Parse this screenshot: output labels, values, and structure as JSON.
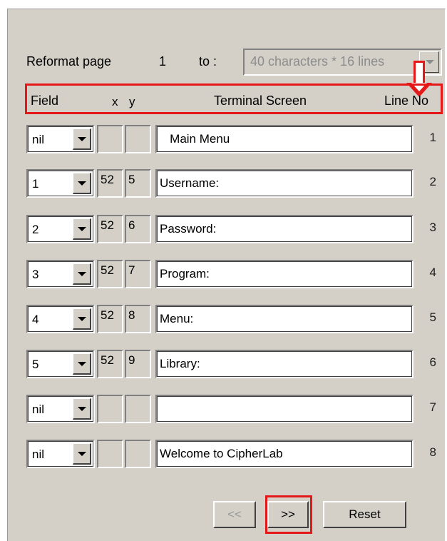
{
  "reformat": {
    "label": "Reformat page",
    "page_number": "1",
    "to_label": "to :",
    "dropdown_value": "40 characters * 16 lines"
  },
  "headers": {
    "field": "Field",
    "x": "x",
    "y": "y",
    "terminal_screen": "Terminal Screen",
    "line_no": "Line No"
  },
  "rows": [
    {
      "field": "nil",
      "x": "",
      "y": "",
      "text": "   Main Menu",
      "line": "1"
    },
    {
      "field": "1",
      "x": "52",
      "y": "5",
      "text": "Username:",
      "line": "2"
    },
    {
      "field": "2",
      "x": "52",
      "y": "6",
      "text": "Password:",
      "line": "3"
    },
    {
      "field": "3",
      "x": "52",
      "y": "7",
      "text": "Program:",
      "line": "4"
    },
    {
      "field": "4",
      "x": "52",
      "y": "8",
      "text": "Menu:",
      "line": "5"
    },
    {
      "field": "5",
      "x": "52",
      "y": "9",
      "text": "Library:",
      "line": "6"
    },
    {
      "field": "nil",
      "x": "",
      "y": "",
      "text": "",
      "line": "7"
    },
    {
      "field": "nil",
      "x": "",
      "y": "",
      "text": "Welcome to CipherLab",
      "line": "8"
    }
  ],
  "buttons": {
    "prev": "<<",
    "next": ">>",
    "reset": "Reset"
  },
  "colors": {
    "panel_bg": "#d4d0c8",
    "highlight_red": "#e41818"
  }
}
